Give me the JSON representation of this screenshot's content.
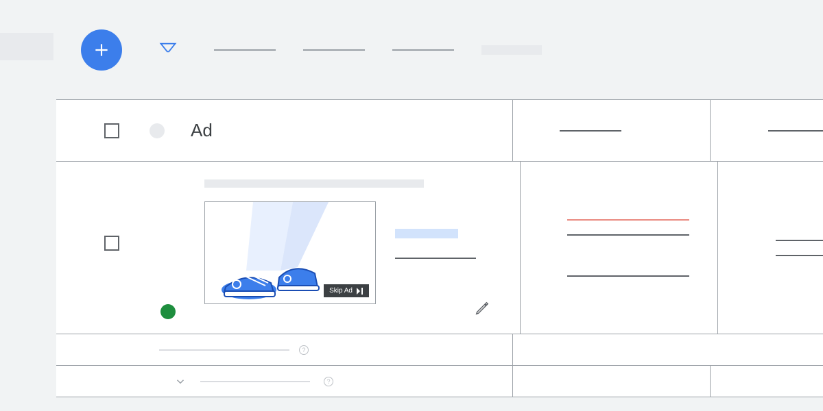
{
  "toolbar": {
    "filter_label": "Filter"
  },
  "header": {
    "title": "Ad"
  },
  "row": {
    "status": "enabled",
    "skip_ad_label": "Skip Ad"
  },
  "colors": {
    "primary": "#3c7eeb",
    "green": "#1e8e3e",
    "red": "#ea8a80"
  }
}
